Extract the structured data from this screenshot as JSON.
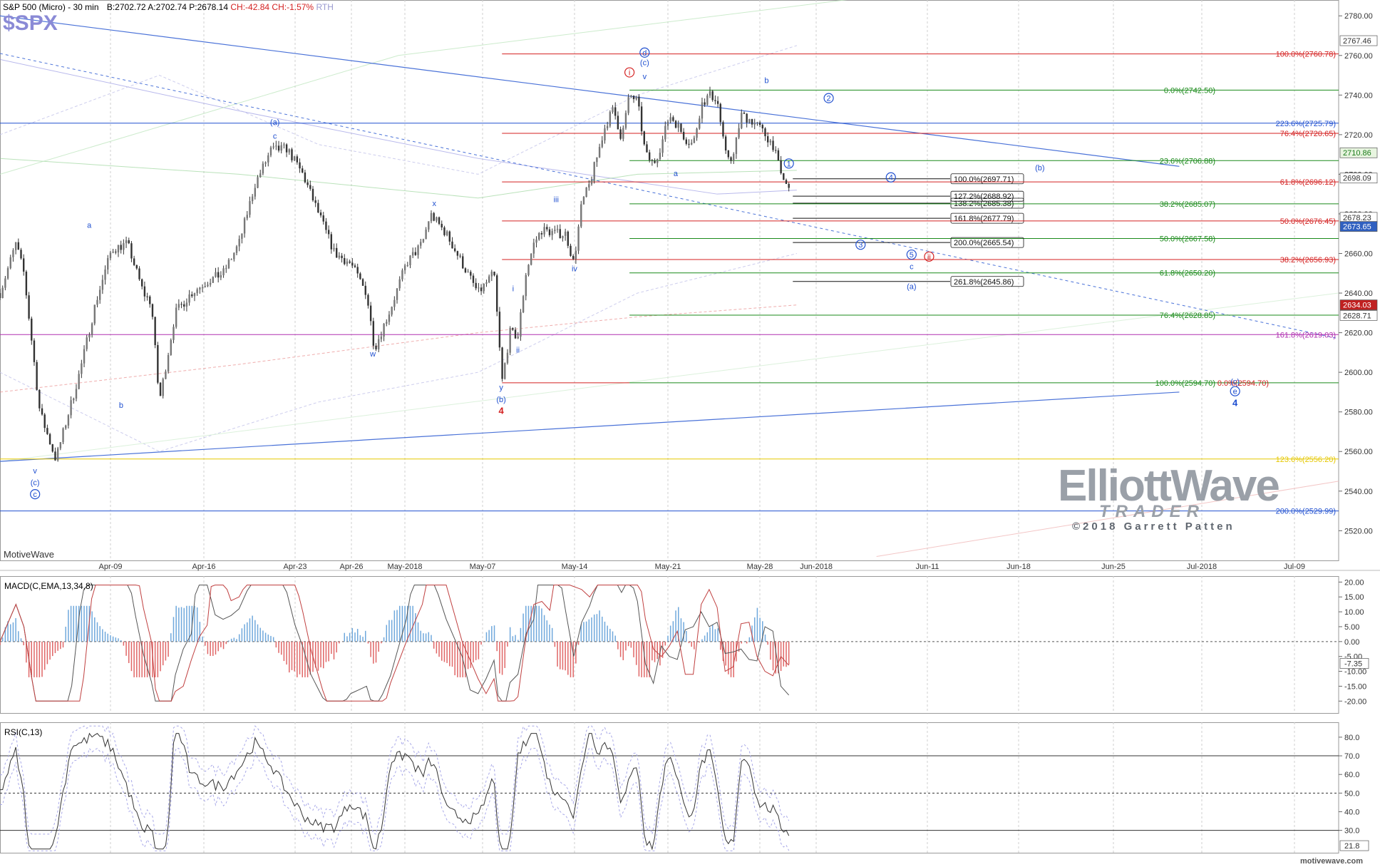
{
  "header": {
    "title": "S&P 500 (Micro) - 30 min",
    "bid": "B:2702.72",
    "ask": "A:2702.74",
    "price": "P:2678.14",
    "change": "CH:-42.84",
    "change_pct": "CH:-1.57%",
    "session": "RTH"
  },
  "symbol": "$SPX",
  "watermark": "MotiveWave",
  "site": "motivewave.com",
  "logo": {
    "line1": "ElliottWave",
    "line2": "TRADER",
    "line3": "©2018 Garrett Patten"
  },
  "colors": {
    "red": "#d42020",
    "green": "#1a8a1a",
    "blue": "#2050d0",
    "purple": "#b030b0",
    "yellow": "#e6c800",
    "black": "#000000"
  },
  "chart_data": [
    {
      "type": "candlestick",
      "title": "S&P 500 (Micro) - 30 min",
      "ylim": [
        2505,
        2788
      ],
      "yticks": [
        2520,
        2540,
        2560,
        2580,
        2600,
        2620,
        2640,
        2660,
        2680,
        2700,
        2720,
        2740,
        2760,
        2780
      ],
      "xlim": [
        "Apr-05",
        "Jul-12"
      ],
      "xticks": [
        "Apr-09",
        "Apr-16",
        "Apr-23",
        "Apr-26",
        "May-2018",
        "May-07",
        "May-14",
        "May-21",
        "May-28",
        "Jun-2018",
        "Jun-11",
        "Jun-18",
        "Jun-25",
        "Jul-2018",
        "Jul-09"
      ],
      "price_path": [
        [
          0,
          2640
        ],
        [
          2,
          2665
        ],
        [
          3,
          2650
        ],
        [
          5,
          2580
        ],
        [
          7,
          2556
        ],
        [
          10,
          2600
        ],
        [
          12,
          2635
        ],
        [
          14,
          2662
        ],
        [
          16,
          2665
        ],
        [
          18,
          2640
        ],
        [
          19,
          2635
        ],
        [
          20,
          2585
        ],
        [
          22,
          2630
        ],
        [
          24,
          2640
        ],
        [
          26,
          2646
        ],
        [
          28,
          2650
        ],
        [
          30,
          2665
        ],
        [
          32,
          2695
        ],
        [
          34,
          2712
        ],
        [
          36,
          2713
        ],
        [
          38,
          2700
        ],
        [
          40,
          2680
        ],
        [
          42,
          2660
        ],
        [
          44,
          2655
        ],
        [
          46,
          2640
        ],
        [
          47,
          2612
        ],
        [
          49,
          2632
        ],
        [
          51,
          2655
        ],
        [
          53,
          2665
        ],
        [
          54,
          2680
        ],
        [
          56,
          2670
        ],
        [
          58,
          2655
        ],
        [
          60,
          2640
        ],
        [
          62,
          2650
        ],
        [
          63,
          2595
        ],
        [
          64,
          2620
        ],
        [
          65,
          2618
        ],
        [
          66,
          2650
        ],
        [
          67,
          2665
        ],
        [
          68,
          2672
        ],
        [
          70,
          2670
        ],
        [
          71,
          2670
        ],
        [
          72,
          2655
        ],
        [
          73,
          2685
        ],
        [
          74,
          2695
        ],
        [
          75,
          2710
        ],
        [
          76,
          2725
        ],
        [
          77,
          2733
        ],
        [
          78,
          2718
        ],
        [
          79,
          2740
        ],
        [
          80,
          2737
        ],
        [
          81,
          2710
        ],
        [
          82,
          2705
        ],
        [
          83,
          2715
        ],
        [
          84,
          2730
        ],
        [
          85,
          2725
        ],
        [
          86,
          2718
        ],
        [
          87,
          2715
        ],
        [
          88,
          2735
        ],
        [
          89,
          2740
        ],
        [
          90,
          2738
        ],
        [
          91,
          2710
        ],
        [
          92,
          2708
        ],
        [
          93,
          2730
        ],
        [
          94,
          2728
        ],
        [
          95,
          2725
        ],
        [
          96,
          2720
        ],
        [
          97,
          2715
        ],
        [
          98,
          2700
        ],
        [
          99,
          2692
        ],
        [
          99.3,
          2678
        ]
      ],
      "lines": [
        {
          "kind": "fib",
          "color": "red",
          "label": "100.0%(2760.78)",
          "value": 2760.78,
          "x0": 63
        },
        {
          "kind": "fib",
          "color": "green",
          "label": "0.0%(2742.50)",
          "value": 2742.5,
          "x0": 79
        },
        {
          "kind": "fib",
          "color": "blue",
          "label": "223.6%(2725.79)",
          "value": 2725.79,
          "x0": 0
        },
        {
          "kind": "fib",
          "color": "red",
          "label": "76.4%(2720.65)",
          "value": 2720.65,
          "x0": 63
        },
        {
          "kind": "fib",
          "color": "green",
          "label": "23.6%(2706.88)",
          "value": 2706.88,
          "x0": 79
        },
        {
          "kind": "ext",
          "color": "black",
          "label": "100.0%(2697.71)",
          "value": 2697.71,
          "x0": 99.5
        },
        {
          "kind": "fib",
          "color": "red",
          "label": "61.8%(2696.12)",
          "value": 2696.12,
          "x0": 63
        },
        {
          "kind": "ext",
          "color": "black",
          "label": "127.2%(2688.92)",
          "value": 2688.92,
          "x0": 99.5
        },
        {
          "kind": "ext",
          "color": "black",
          "label": "138.2%(2685.38)",
          "value": 2685.38,
          "x0": 99.5
        },
        {
          "kind": "fib",
          "color": "green",
          "label": "38.2%(2685.07)",
          "value": 2685.07,
          "x0": 79
        },
        {
          "kind": "ext",
          "color": "black",
          "label": "161.8%(2677.79)",
          "value": 2677.79,
          "x0": 99.5
        },
        {
          "kind": "fib",
          "color": "red",
          "label": "50.0%(2676.45)",
          "value": 2676.45,
          "x0": 63
        },
        {
          "kind": "fib",
          "color": "green",
          "label": "50.0%(2667.58)",
          "value": 2667.58,
          "x0": 79
        },
        {
          "kind": "ext",
          "color": "black",
          "label": "200.0%(2665.54)",
          "value": 2665.54,
          "x0": 99.5
        },
        {
          "kind": "fib",
          "color": "red",
          "label": "38.2%(2656.93)",
          "value": 2656.93,
          "x0": 63
        },
        {
          "kind": "fib",
          "color": "green",
          "label": "61.8%(2650.20)",
          "value": 2650.2,
          "x0": 79
        },
        {
          "kind": "ext",
          "color": "black",
          "label": "261.8%(2645.86)",
          "value": 2645.86,
          "x0": 99.5
        },
        {
          "kind": "fib",
          "color": "green",
          "label": "76.4%(2628.85)",
          "value": 2628.85,
          "x0": 79
        },
        {
          "kind": "fib",
          "color": "purple",
          "label": "161.8%(2619.03)",
          "value": 2619.03,
          "x0": 0
        },
        {
          "kind": "fib",
          "color": "green",
          "label": "100.0%(2594.70)",
          "value": 2594.7,
          "x0": 79
        },
        {
          "kind": "fib",
          "color": "red",
          "label": "0.0%(2594.70)",
          "value": 2594.7,
          "x0": 63
        },
        {
          "kind": "fib",
          "color": "yellow",
          "label": "123.6%(2556.20)",
          "value": 2556.2,
          "x0": 0
        },
        {
          "kind": "fib",
          "color": "blue",
          "label": "200.0%(2529.99)",
          "value": 2529.99,
          "x0": 0
        }
      ],
      "axis_price_boxes": [
        "2767.46",
        "2710.86",
        "2698.09",
        "2678.23",
        "2673.65",
        "2634.03",
        "2628.71"
      ],
      "wave_labels": [
        {
          "text": "a",
          "x": 11.2,
          "y": 2673,
          "color": "blue"
        },
        {
          "text": "b",
          "x": 15.2,
          "y": 2582,
          "color": "blue"
        },
        {
          "text": "(a)",
          "x": 34.5,
          "y": 2725,
          "color": "blue"
        },
        {
          "text": "c",
          "x": 34.5,
          "y": 2718,
          "color": "blue"
        },
        {
          "text": "x",
          "x": 54.5,
          "y": 2684,
          "color": "blue"
        },
        {
          "text": "w",
          "x": 46.8,
          "y": 2608,
          "color": "blue"
        },
        {
          "text": "y",
          "x": 62.9,
          "y": 2591,
          "color": "blue"
        },
        {
          "text": "(b)",
          "x": 62.9,
          "y": 2585,
          "color": "blue"
        },
        {
          "text": "4",
          "x": 62.9,
          "y": 2579,
          "color": "red",
          "bold": true
        },
        {
          "text": "i",
          "x": 64.4,
          "y": 2641,
          "color": "blue"
        },
        {
          "text": "ii",
          "x": 65,
          "y": 2610,
          "color": "blue"
        },
        {
          "text": "iii",
          "x": 69.8,
          "y": 2686,
          "color": "blue"
        },
        {
          "text": "iv",
          "x": 72.1,
          "y": 2651,
          "color": "blue"
        },
        {
          "text": "v",
          "x": 80.9,
          "y": 2748,
          "color": "blue"
        },
        {
          "text": "(c)",
          "x": 80.9,
          "y": 2755,
          "color": "blue"
        },
        {
          "text": "d",
          "x": 80.9,
          "y": 2760,
          "color": "blue",
          "circle": true
        },
        {
          "text": "i",
          "x": 79,
          "y": 2750,
          "color": "red",
          "circle": true
        },
        {
          "text": "a",
          "x": 84.8,
          "y": 2699,
          "color": "blue"
        },
        {
          "text": "b",
          "x": 96.2,
          "y": 2746,
          "color": "blue"
        },
        {
          "text": "1",
          "x": 99,
          "y": 2704,
          "color": "blue",
          "circle": true
        },
        {
          "text": "2",
          "x": 104,
          "y": 2737,
          "color": "blue",
          "circle": true
        },
        {
          "text": "3",
          "x": 108,
          "y": 2663,
          "color": "blue",
          "circle": true
        },
        {
          "text": "4",
          "x": 111.8,
          "y": 2697,
          "color": "blue",
          "circle": true
        },
        {
          "text": "(b)",
          "x": 130.5,
          "y": 2702,
          "color": "blue"
        },
        {
          "text": "5",
          "x": 114.4,
          "y": 2658,
          "color": "blue",
          "circle": true
        },
        {
          "text": "ii",
          "x": 116.6,
          "y": 2657,
          "color": "red",
          "circle": true
        },
        {
          "text": "c",
          "x": 114.4,
          "y": 2652,
          "color": "blue"
        },
        {
          "text": "(a)",
          "x": 114.4,
          "y": 2642,
          "color": "blue"
        },
        {
          "text": "(c)",
          "x": 155,
          "y": 2594,
          "color": "blue"
        },
        {
          "text": "e",
          "x": 155,
          "y": 2589,
          "color": "blue",
          "circle": true
        },
        {
          "text": "4",
          "x": 155,
          "y": 2583,
          "color": "blue",
          "bold": true
        },
        {
          "text": "v",
          "x": 4.4,
          "y": 2549,
          "color": "blue"
        },
        {
          "text": "(c)",
          "x": 4.4,
          "y": 2543,
          "color": "blue"
        },
        {
          "text": "c",
          "x": 4.4,
          "y": 2537,
          "color": "blue",
          "circle": true
        }
      ]
    },
    {
      "type": "line",
      "title": "MACD(C,EMA,13,34,8)",
      "ylim": [
        -24,
        22
      ],
      "yticks": [
        20,
        15,
        10,
        5,
        0,
        -5,
        -10,
        -15,
        -20
      ],
      "ytick_labels": [
        "20.00",
        "15.00",
        "10.00",
        "5.00",
        "0.00",
        "-5.00",
        "-10.00",
        "-15.00",
        "-20.00"
      ],
      "last_value": "-7.35"
    },
    {
      "type": "line",
      "title": "RSI(C,13)",
      "ylim": [
        18,
        88
      ],
      "yticks": [
        80,
        70,
        60,
        50,
        40,
        30
      ],
      "ytick_labels": [
        "80.0",
        "70.0",
        "60.0",
        "50.0",
        "40.0",
        "30.0"
      ],
      "levels": [
        70,
        50,
        30
      ],
      "last_value": "21.8"
    }
  ]
}
